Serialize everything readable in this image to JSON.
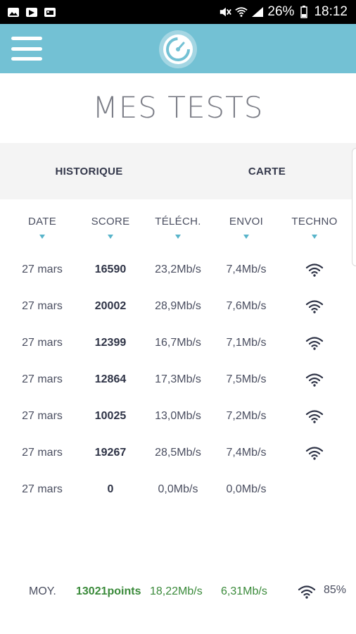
{
  "status_bar": {
    "battery": "26%",
    "time": "18:12"
  },
  "app_bar": {
    "menu_icon": "hamburger-icon",
    "logo_icon": "speedometer-logo-icon"
  },
  "page": {
    "title": "MES TESTS"
  },
  "tabs": [
    {
      "label": "HISTORIQUE"
    },
    {
      "label": "CARTE"
    }
  ],
  "columns": [
    {
      "label": "DATE"
    },
    {
      "label": "SCORE"
    },
    {
      "label": "TÉLÉCH."
    },
    {
      "label": "ENVOI"
    },
    {
      "label": "TECHNO"
    }
  ],
  "rows": [
    {
      "date": "27 mars",
      "score": "16590",
      "download": "23,2Mb/s",
      "upload": "7,4Mb/s",
      "techno": "wifi"
    },
    {
      "date": "27 mars",
      "score": "20002",
      "download": "28,9Mb/s",
      "upload": "7,6Mb/s",
      "techno": "wifi"
    },
    {
      "date": "27 mars",
      "score": "12399",
      "download": "16,7Mb/s",
      "upload": "7,1Mb/s",
      "techno": "wifi"
    },
    {
      "date": "27 mars",
      "score": "12864",
      "download": "17,3Mb/s",
      "upload": "7,5Mb/s",
      "techno": "wifi"
    },
    {
      "date": "27 mars",
      "score": "10025",
      "download": "13,0Mb/s",
      "upload": "7,2Mb/s",
      "techno": "wifi"
    },
    {
      "date": "27 mars",
      "score": "19267",
      "download": "28,5Mb/s",
      "upload": "7,4Mb/s",
      "techno": "wifi"
    },
    {
      "date": "27 mars",
      "score": "0",
      "download": "0,0Mb/s",
      "upload": "0,0Mb/s",
      "techno": ""
    }
  ],
  "average": {
    "label": "MOY.",
    "score": "13021points",
    "download": "18,22Mb/s",
    "upload": "6,31Mb/s",
    "techno": "wifi",
    "techno_share": "85%"
  },
  "colors": {
    "app_bar": "#73c1d4",
    "accent": "#58b4ca",
    "average_green": "#3a8a3a"
  }
}
